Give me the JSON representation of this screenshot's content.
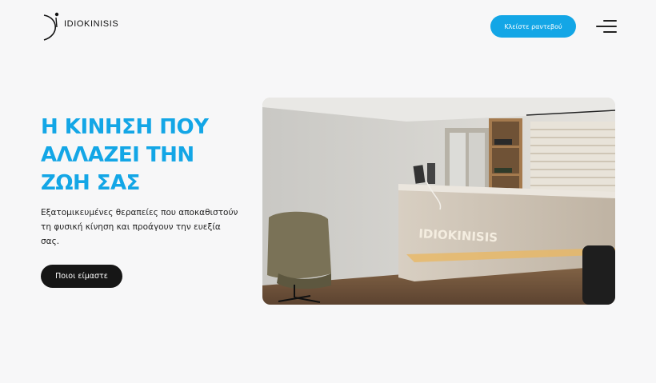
{
  "header": {
    "brand_name": "IDIOKINISIS",
    "cta_label": "Κλείστε ραντεβού",
    "menu_icon": "hamburger-menu-icon"
  },
  "hero": {
    "title": "Η ΚΙΝΗΣΗ ΠΟΥ ΑΛΛΑΖΕΙ ΤΗΝ ΖΩΗ ΣΑΣ",
    "description": "Εξατομικευμένες θεραπείες που αποκαθιστούν τη φυσική κίνηση και προάγουν την ευεξία σας.",
    "button_label": "Ποιοι είμαστε",
    "image_sign_text": "IDIOKINISIS"
  },
  "colors": {
    "accent": "#13a6e6",
    "dark_button": "#161616",
    "background": "#f7f7f8"
  }
}
